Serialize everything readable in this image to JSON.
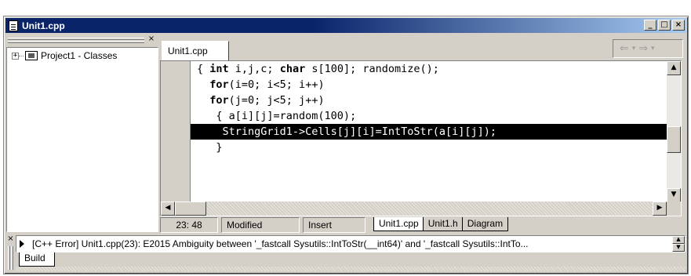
{
  "window": {
    "title": "Unit1.cpp"
  },
  "title_buttons": {
    "minimize": "_",
    "maximize": "□",
    "close": "×"
  },
  "explorer": {
    "close": "×",
    "tree": [
      {
        "expander": "+",
        "label": "Project1 - Classes"
      }
    ]
  },
  "editor": {
    "tab_label": "Unit1.cpp",
    "nav": {
      "back": "⇐",
      "back_dd": "▾",
      "forward": "⇒",
      "forward_dd": "▾"
    }
  },
  "code_lines": [
    {
      "pre": "{ ",
      "kw": "int",
      "post": " i,j,c; ",
      "kw2": "char",
      "post2": " s[100]; randomize();"
    },
    {
      "pre": "  ",
      "kw": "for",
      "post": "(i=0; i<5; i++)"
    },
    {
      "pre": "  ",
      "kw": "for",
      "post": "(j=0; j<5; j++)"
    },
    {
      "pre": "   { a[i][j]=random(100);"
    },
    {
      "pre": "    StringGrid1->Cells[j][i]=IntToStr(a[i][j]);",
      "selected": true
    },
    {
      "pre": "   }"
    }
  ],
  "status": {
    "position": "23: 48",
    "modified": "Modified",
    "insert_mode": "Insert",
    "file_tabs": [
      "Unit1.cpp",
      "Unit1.h",
      "Diagram"
    ]
  },
  "messages": {
    "close": "×",
    "text": "[C++ Error] Unit1.cpp(23): E2015 Ambiguity between '_fastcall Sysutils::IntToStr(__int64)' and '_fastcall Sysutils::IntTo...",
    "tab": "Build"
  },
  "scroll_arrows": {
    "up": "▲",
    "down": "▼",
    "left": "◀",
    "right": "▶"
  }
}
